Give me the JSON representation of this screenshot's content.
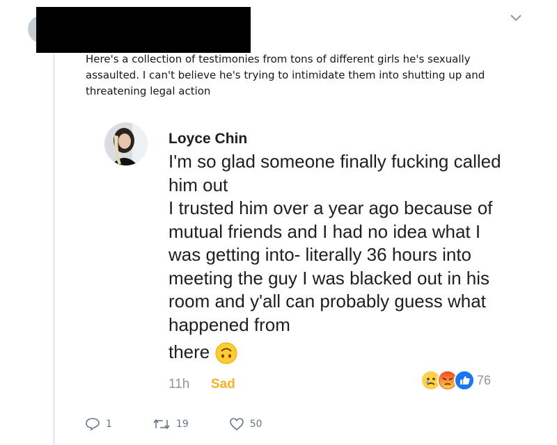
{
  "tweet": {
    "text": "Here's a collection of testimonies from tons of different girls he's sexually assaulted. I can't believe he's trying to intimidate them into shutting up and threatening legal action",
    "reply_count": "1",
    "retweet_count": "19",
    "like_count": "50",
    "icons": {
      "more": "chevron-down-icon",
      "reply": "reply-icon",
      "retweet": "retweet-icon",
      "like": "heart-icon"
    }
  },
  "embedded_comment": {
    "author": "Loyce Chin",
    "body_lines": [
      "I'm so glad someone finally fucking called him out",
      "I trusted him over a year ago because of mutual friends and I had no idea what I was getting into- literally 36 hours into meeting the guy I was blacked out in his room and y'all can probably guess what happened from",
      "there"
    ],
    "time": "11h",
    "reaction_label": "Sad",
    "reaction_count": "76",
    "colors": {
      "sad": "#f7b125",
      "meta": "#90949c",
      "like_blue": "#1877f2"
    }
  }
}
